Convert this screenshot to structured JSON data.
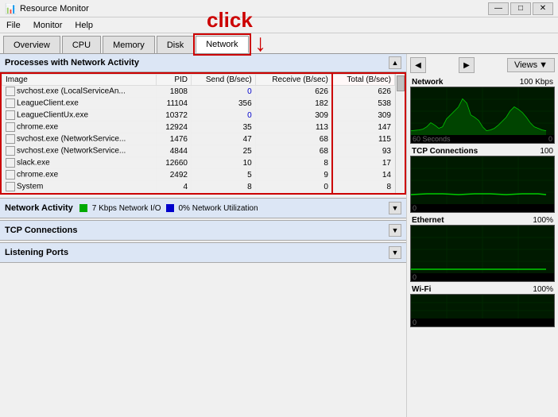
{
  "titleBar": {
    "icon": "📊",
    "title": "Resource Monitor",
    "controls": [
      "—",
      "□",
      "✕"
    ]
  },
  "menuBar": {
    "items": [
      "File",
      "Monitor",
      "Help"
    ]
  },
  "navTabs": {
    "tabs": [
      "Overview",
      "CPU",
      "Memory",
      "Disk",
      "Network"
    ],
    "active": "Network"
  },
  "processList": {
    "sectionTitle": "Processes with Network Activity",
    "columns": [
      "Image",
      "PID",
      "Send (B/sec)",
      "Receive (B/sec)",
      "Total (B/sec)"
    ],
    "rows": [
      {
        "image": "svchost.exe (LocalServiceAn...",
        "pid": "1808",
        "send": "0",
        "receive": "626",
        "total": "626"
      },
      {
        "image": "LeagueClient.exe",
        "pid": "11104",
        "send": "356",
        "receive": "182",
        "total": "538"
      },
      {
        "image": "LeagueClientUx.exe",
        "pid": "10372",
        "send": "0",
        "receive": "309",
        "total": "309"
      },
      {
        "image": "chrome.exe",
        "pid": "12924",
        "send": "35",
        "receive": "113",
        "total": "147"
      },
      {
        "image": "svchost.exe (NetworkService...",
        "pid": "1476",
        "send": "47",
        "receive": "68",
        "total": "115"
      },
      {
        "image": "svchost.exe (NetworkService...",
        "pid": "4844",
        "send": "25",
        "receive": "68",
        "total": "93"
      },
      {
        "image": "slack.exe",
        "pid": "12660",
        "send": "10",
        "receive": "8",
        "total": "17"
      },
      {
        "image": "chrome.exe",
        "pid": "2492",
        "send": "5",
        "receive": "9",
        "total": "14"
      },
      {
        "image": "System",
        "pid": "4",
        "send": "8",
        "receive": "0",
        "total": "8"
      }
    ]
  },
  "networkActivity": {
    "title": "Network Activity",
    "ioLabel": "7 Kbps Network I/O",
    "utilizationLabel": "0% Network Utilization",
    "collapseIcon": "▼"
  },
  "tcpConnections": {
    "title": "TCP Connections",
    "collapseIcon": "▼"
  },
  "listeningPorts": {
    "title": "Listening Ports",
    "collapseIcon": "▼"
  },
  "rightPanel": {
    "viewsLabel": "Views",
    "navPrevIcon": "◀",
    "navNextIcon": "▶",
    "graphs": [
      {
        "name": "Network",
        "scale": "100 Kbps",
        "timeLabel": "60 Seconds",
        "timeValue": "0"
      },
      {
        "name": "TCP Connections",
        "scale": "100",
        "timeValue": "0"
      },
      {
        "name": "Ethernet",
        "scale": "100%",
        "timeValue": "0"
      },
      {
        "name": "Wi-Fi",
        "scale": "100%",
        "timeValue": "0"
      }
    ]
  },
  "clickAnnotation": {
    "label": "click",
    "arrowLabel": "↓"
  }
}
